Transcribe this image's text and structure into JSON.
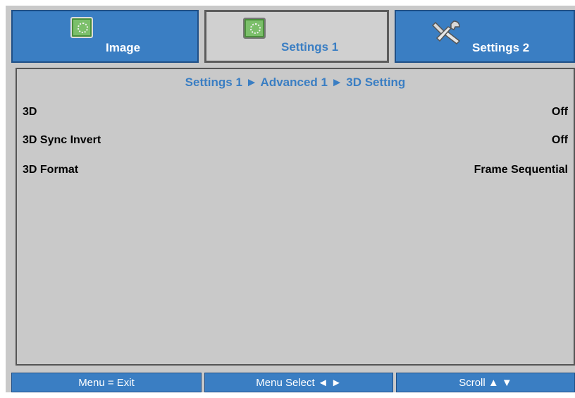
{
  "tabs": [
    {
      "label": "Image",
      "icon": "image-icon",
      "active": false
    },
    {
      "label": "Settings 1",
      "icon": "image-icon",
      "active": true
    },
    {
      "label": "Settings 2",
      "icon": "tools-icon",
      "active": false
    }
  ],
  "breadcrumb": "Settings 1 ► Advanced 1 ► 3D Setting",
  "settings": [
    {
      "name": "3D",
      "value": "Off"
    },
    {
      "name": "3D Sync Invert",
      "value": "Off"
    },
    {
      "name": "3D Format",
      "value": "Frame Sequential"
    }
  ],
  "footer": {
    "exit": "Menu = Exit",
    "select": "Menu Select ◄ ►",
    "scroll": "Scroll ▲ ▼"
  },
  "colors": {
    "accent": "#3a7ec3",
    "panel_bg": "#c9c9c9",
    "active_tab_bg": "#d0d0d0"
  }
}
